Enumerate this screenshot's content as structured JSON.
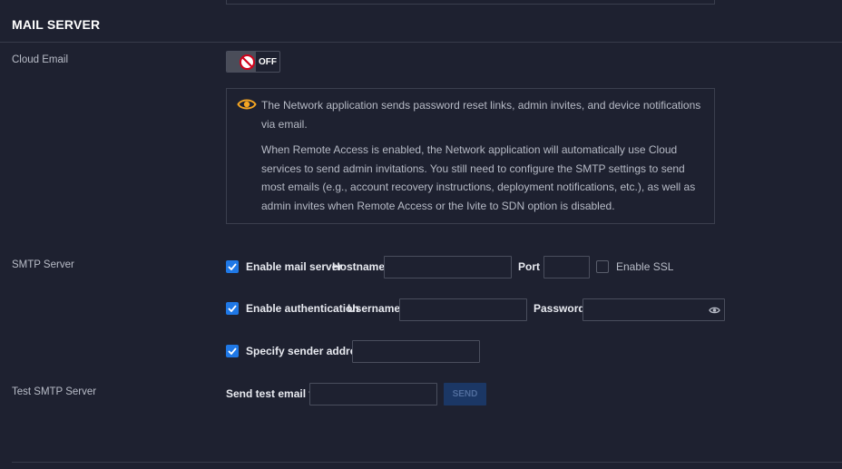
{
  "section": {
    "title": "MAIL SERVER"
  },
  "cloud_email": {
    "label": "Cloud Email",
    "toggle_state": "OFF",
    "info_line_1": "The Network application sends password reset links, admin invites, and device notifications via email.",
    "info_line_2": "When Remote Access is enabled, the Network application will automatically use Cloud services to send admin invitations. You still need to configure the SMTP settings to send most emails (e.g., account recovery instructions, deployment notifications, etc.), as well as admin invites when Remote Access or the Ivite to SDN option is disabled."
  },
  "smtp": {
    "label": "SMTP Server",
    "enable_mail_server": "Enable mail server",
    "hostname_label": "Hostname",
    "hostname_value": "",
    "port_label": "Port",
    "port_value": "",
    "enable_ssl": "Enable SSL",
    "enable_auth": "Enable authentication",
    "username_label": "Username",
    "username_value": "",
    "password_label": "Password",
    "password_value": "",
    "specify_sender": "Specify sender address",
    "sender_value": ""
  },
  "test_smtp": {
    "label": "Test SMTP Server",
    "send_to_label": "Send test email to",
    "send_to_value": "",
    "send_button": "SEND"
  },
  "colors": {
    "background": "#1e2130",
    "accent": "#1f78e6",
    "warning_icon": "#f5a623",
    "disabled_button": "#1b3765"
  },
  "icons": {
    "info": "eye-icon",
    "toggle": "no-entry-icon",
    "password_reveal": "eye-icon",
    "check": "checkmark-icon"
  }
}
